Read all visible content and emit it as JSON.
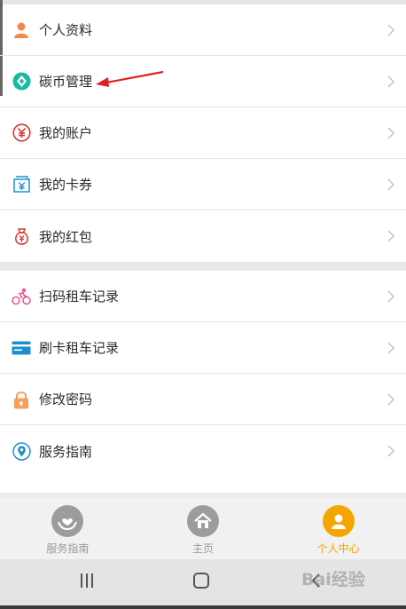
{
  "menu_group_1": [
    {
      "label": "个人资料",
      "icon": "person-icon"
    },
    {
      "label": "碳币管理",
      "icon": "carbon-coin-icon"
    },
    {
      "label": "我的账户",
      "icon": "yuan-account-icon"
    },
    {
      "label": "我的卡券",
      "icon": "coupon-icon"
    },
    {
      "label": "我的红包",
      "icon": "red-packet-icon"
    }
  ],
  "menu_group_2": [
    {
      "label": "扫码租车记录",
      "icon": "bike-icon"
    },
    {
      "label": "刷卡租车记录",
      "icon": "card-icon"
    },
    {
      "label": "修改密码",
      "icon": "lock-icon"
    },
    {
      "label": "服务指南",
      "icon": "location-pin-icon"
    }
  ],
  "tabs": [
    {
      "label": "服务指南",
      "icon": "heart-hands-icon",
      "active": false
    },
    {
      "label": "主页",
      "icon": "home-icon",
      "active": false
    },
    {
      "label": "个人中心",
      "icon": "user-icon",
      "active": true
    }
  ],
  "watermark": "Bai经验",
  "colors": {
    "accent": "#f5a500",
    "inactive": "#999999",
    "arrow": "#e02020",
    "person": "#f08a4b",
    "teal": "#1ab8a6",
    "red": "#d9342b",
    "blue": "#1d8fcf",
    "pink": "#e8579a",
    "orange": "#f3a15a"
  }
}
